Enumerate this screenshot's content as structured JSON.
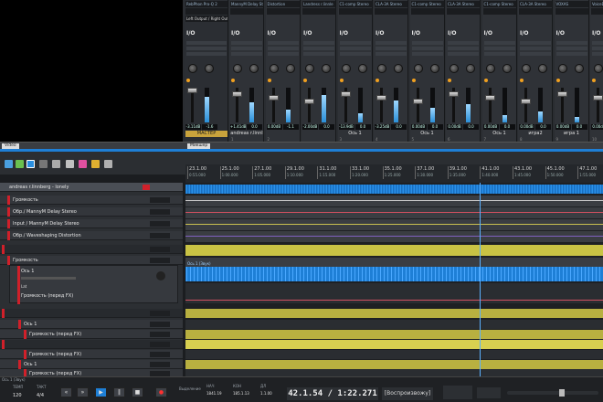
{
  "panes": {
    "video_tab": "Video",
    "mixer_tab": "Микшер"
  },
  "mixer": {
    "master": {
      "plugin": "RebPhon Pro-Q 2",
      "io_label": "I/O",
      "sub_label": "Left Output / Right Output",
      "db_left": "-3.11dB",
      "db_right": "-1.6",
      "name": "МАСТЕР"
    },
    "strips": [
      {
        "plugin": "MannyM Delay Stereo",
        "db_left": "+1.41dB",
        "db_right": "0.0",
        "name": "andreas r.linnl",
        "num": "1"
      },
      {
        "plugin": "Distortion",
        "db_left": "0.00dB",
        "db_right": "-1.1",
        "name": "",
        "num": "2"
      },
      {
        "plugin": "Landress r.linnle",
        "db_left": "-2.00dB",
        "db_right": "0.0",
        "name": "",
        "num": ""
      },
      {
        "plugin": "C1-comp Stereo",
        "db_left": "-13.9dB",
        "db_right": "0.0",
        "name": "Ось 1",
        "num": "3"
      },
      {
        "plugin": "CLA-3A Stereo",
        "db_left": "-3.25dB",
        "db_right": "0.0",
        "name": "",
        "num": "4"
      },
      {
        "plugin": "C1-comp Stereo",
        "db_left": "0.00dB",
        "db_right": "0.0",
        "name": "Ось 1",
        "num": "5"
      },
      {
        "plugin": "CLA-3A Stereo",
        "db_left": "0.00dB",
        "db_right": "0.0",
        "name": "",
        "num": "6"
      },
      {
        "plugin": "C1-comp Stereo",
        "db_left": "0.00dB",
        "db_right": "0.0",
        "name": "Ось 1",
        "num": "7"
      },
      {
        "plugin": "CLA-3A Stereo",
        "db_left": "0.00dB",
        "db_right": "0.0",
        "name": "игра2",
        "num": "8"
      },
      {
        "plugin": "VOXAS",
        "db_left": "0.00dB",
        "db_right": "0.0",
        "name": "игра 1",
        "num": "9"
      },
      {
        "plugin": "VoiceDesigner",
        "db_left": "0.00dB",
        "db_right": "0.0",
        "name": "",
        "num": "10"
      }
    ]
  },
  "ruler": {
    "bars": [
      "23.1.00",
      "25.1.00",
      "27.1.00",
      "29.1.00",
      "31.1.00",
      "33.1.00",
      "35.1.00",
      "37.1.00",
      "39.1.00",
      "41.1.00",
      "43.1.00",
      "45.1.00",
      "47.1.00"
    ],
    "times": [
      "0:55.000",
      "1:00.000",
      "1:05.000",
      "1:10.000",
      "1:15.000",
      "1:20.000",
      "1:25.000",
      "1:30.000",
      "1:35.000",
      "1:40.000",
      "1:45.000",
      "1:50.000",
      "1:55.000"
    ]
  },
  "tracks": {
    "main_track": "andreas r.linnberg - lonely",
    "rows": [
      "Громкость",
      "Обр./ MannyM Delay Stereo",
      "Input / MannyM Delay Stereo",
      "Обр./ Waveshaping Distortion"
    ],
    "bus_row": "",
    "volume2": "Громкость",
    "axis1": "Ось 1",
    "lat": "Lat",
    "volume_pre": "Громкость (перед FX)",
    "axis1_b": "Ось 1",
    "volume_pre_b": "Громкость (перед FX)",
    "volume_pre_c": "Громкость (перед FX)",
    "axis1_c": "Ось 1",
    "volume_pre_d": "Громкость (перед FX)",
    "lane_label": "Ось 1 (Звук)"
  },
  "transport": {
    "tempo_label": "ТЕМП",
    "tempo_value": "120",
    "sig_label": "ТАКТ",
    "sig_value": "4/4",
    "clock": "42.1.54 / 1:22.271",
    "mode": "[Воспроизвожу]",
    "sel_label": "Выделение",
    "start_label": "НАЧ",
    "start_value": "1841.19",
    "end_label": "КОН",
    "end_value": "185.1.13",
    "len_label": "ДЛ",
    "len_value": "1.1.00",
    "status": "Ось 1 (Звук)"
  },
  "colors": {
    "accent_blue": "#1e7fd6",
    "track_yellow": "#e8e04a",
    "record_red": "#d0202a",
    "master_gold": "#c9a33c"
  }
}
